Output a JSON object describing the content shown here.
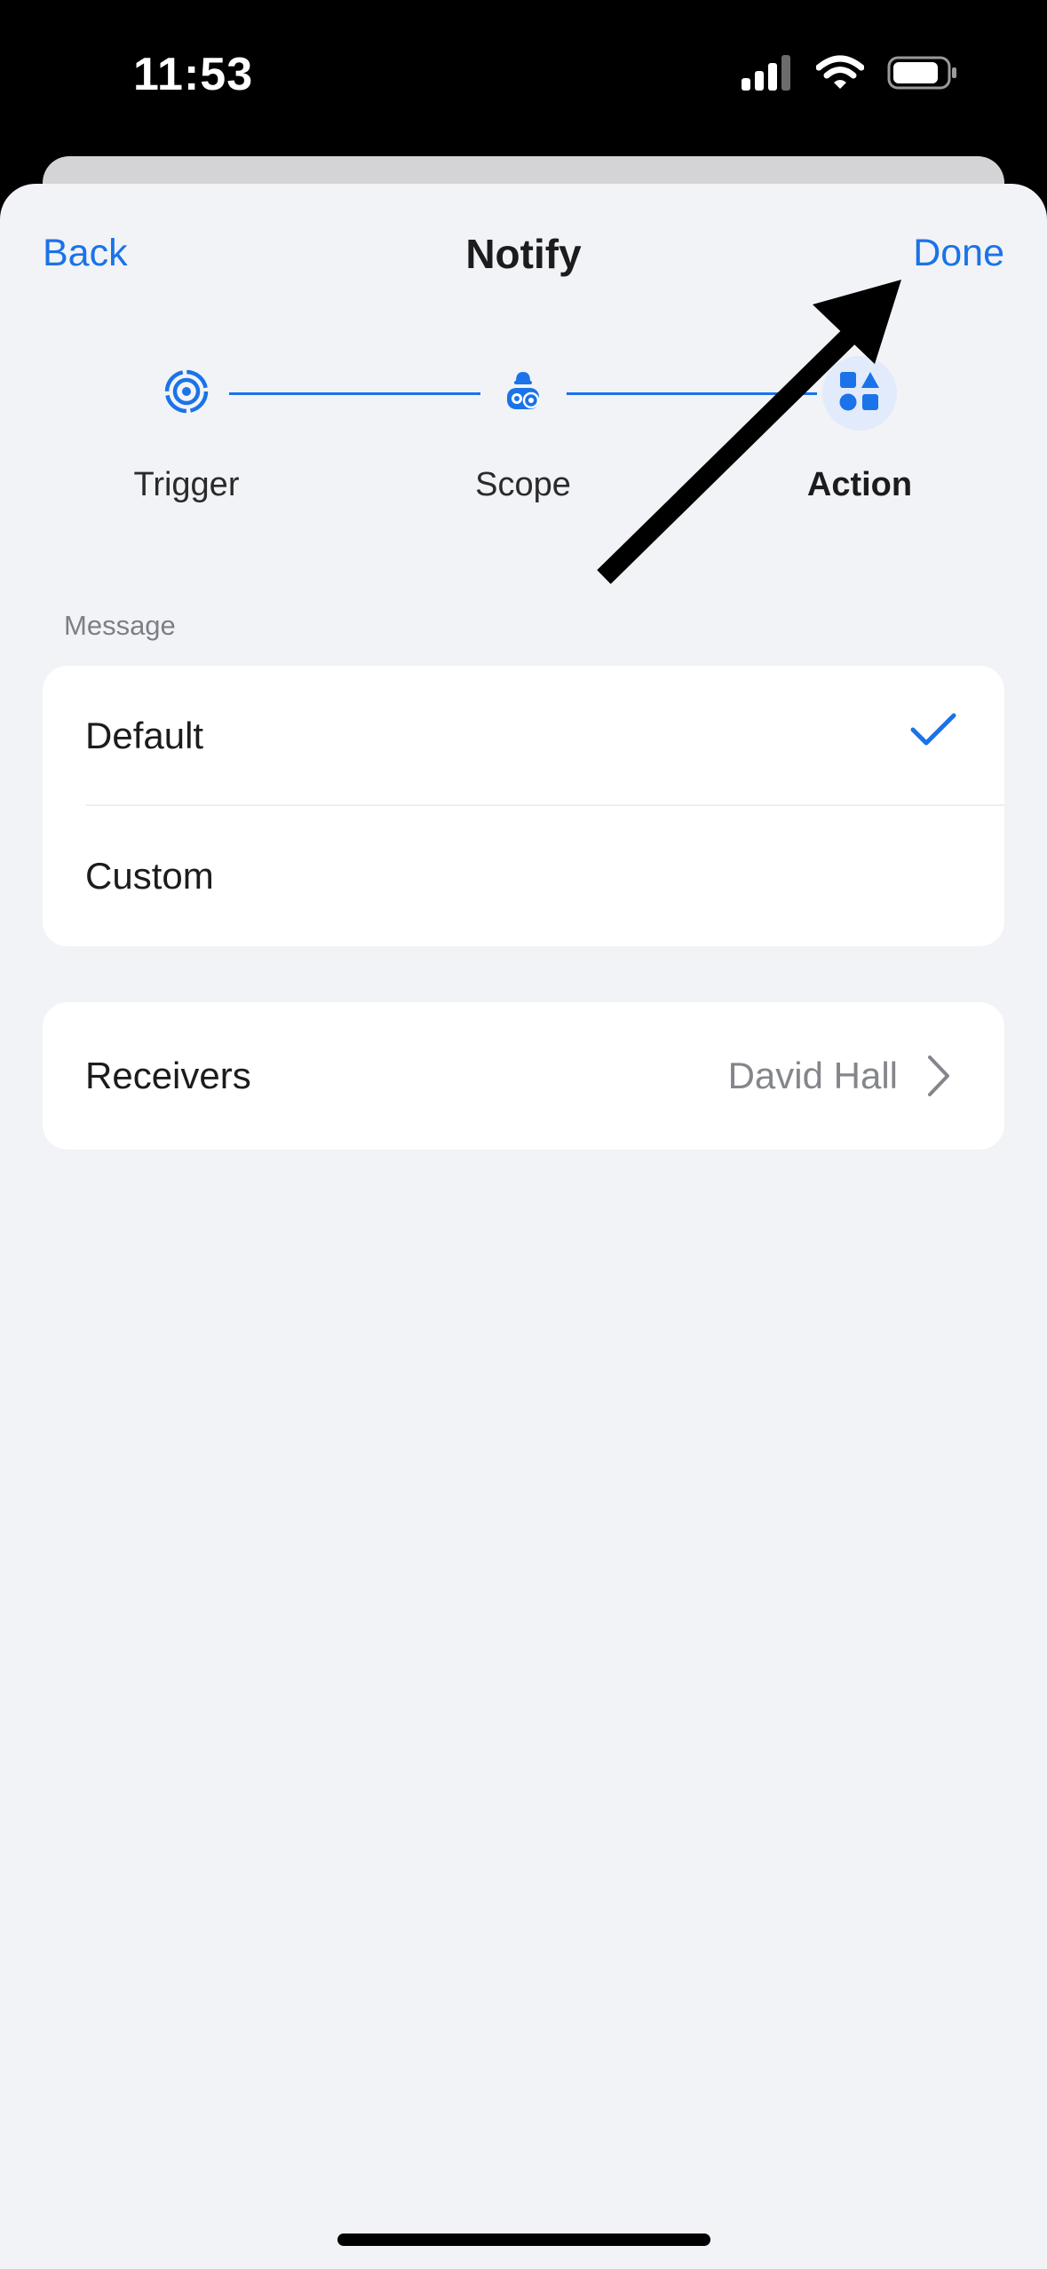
{
  "status_bar": {
    "time": "11:53",
    "icons": [
      "cellular-signal-icon",
      "wifi-icon",
      "battery-icon"
    ]
  },
  "nav": {
    "back_label": "Back",
    "title": "Notify",
    "done_label": "Done"
  },
  "stepper": {
    "steps": [
      {
        "label": "Trigger",
        "icon": "target-icon",
        "active": false
      },
      {
        "label": "Scope",
        "icon": "scope-icon",
        "active": false
      },
      {
        "label": "Action",
        "icon": "shapes-icon",
        "active": true
      }
    ]
  },
  "message": {
    "section_label": "Message",
    "options": [
      {
        "label": "Default",
        "selected": true
      },
      {
        "label": "Custom",
        "selected": false
      }
    ]
  },
  "receivers": {
    "label": "Receivers",
    "value": "David Hall"
  },
  "colors": {
    "accent": "#1a73e8",
    "background": "#f2f3f6",
    "card": "#ffffff",
    "secondary_text": "#84868c"
  }
}
